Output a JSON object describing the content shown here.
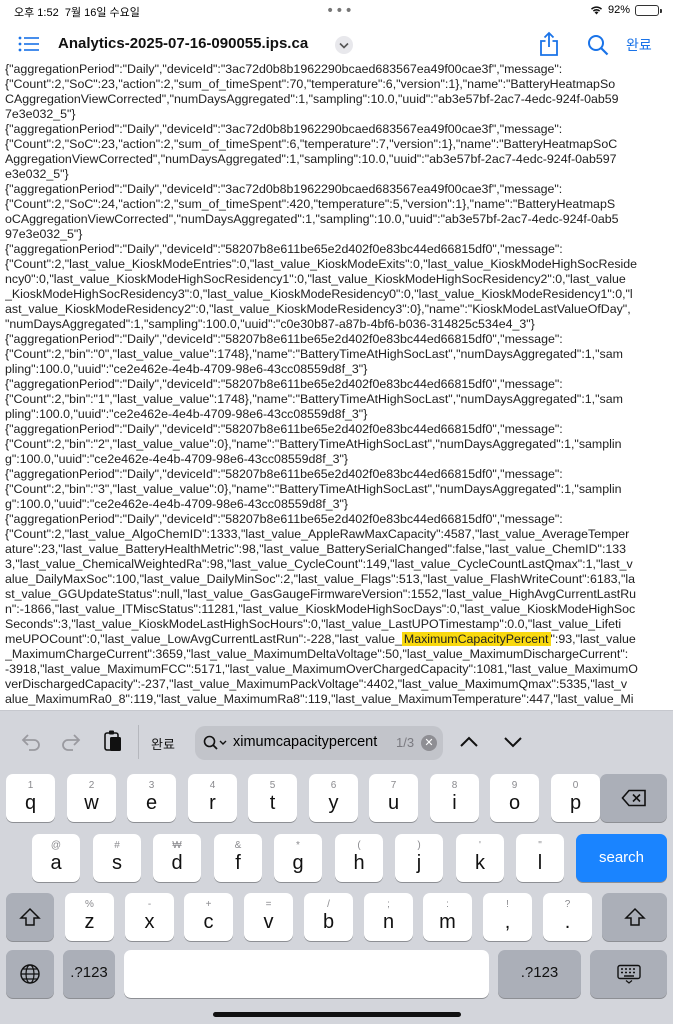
{
  "status": {
    "time": "오후 1:52",
    "date": "7월 16일 수요일",
    "battery": "92%",
    "battery_level": 0.92
  },
  "nav": {
    "title": "Analytics-2025-07-16-090055.ips.ca",
    "done": "완료"
  },
  "document": {
    "lines_before": [
      "{\"aggregationPeriod\":\"Daily\",\"deviceId\":\"3ac72d0b8b1962290bcaed683567ea49f00cae3f\",\"message\":",
      "{\"Count\":2,\"SoC\":23,\"action\":2,\"sum_of_timeSpent\":70,\"temperature\":6,\"version\":1},\"name\":\"BatteryHeatmapSo",
      "CAggregationViewCorrected\",\"numDaysAggregated\":1,\"sampling\":10.0,\"uuid\":\"ab3e57bf-2ac7-4edc-924f-0ab59",
      "7e3e032_5\"}",
      "{\"aggregationPeriod\":\"Daily\",\"deviceId\":\"3ac72d0b8b1962290bcaed683567ea49f00cae3f\",\"message\":",
      "{\"Count\":2,\"SoC\":23,\"action\":2,\"sum_of_timeSpent\":6,\"temperature\":7,\"version\":1},\"name\":\"BatteryHeatmapSoC",
      "AggregationViewCorrected\",\"numDaysAggregated\":1,\"sampling\":10.0,\"uuid\":\"ab3e57bf-2ac7-4edc-924f-0ab597",
      "e3e032_5\"}",
      "{\"aggregationPeriod\":\"Daily\",\"deviceId\":\"3ac72d0b8b1962290bcaed683567ea49f00cae3f\",\"message\":",
      "{\"Count\":2,\"SoC\":24,\"action\":2,\"sum_of_timeSpent\":420,\"temperature\":5,\"version\":1},\"name\":\"BatteryHeatmapS",
      "oCAggregationViewCorrected\",\"numDaysAggregated\":1,\"sampling\":10.0,\"uuid\":\"ab3e57bf-2ac7-4edc-924f-0ab5",
      "97e3e032_5\"}",
      "{\"aggregationPeriod\":\"Daily\",\"deviceId\":\"58207b8e611be65e2d402f0e83bc44ed66815df0\",\"message\":",
      "{\"Count\":2,\"last_value_KioskModeEntries\":0,\"last_value_KioskModeExits\":0,\"last_value_KioskModeHighSocReside",
      "ncy0\":0,\"last_value_KioskModeHighSocResidency1\":0,\"last_value_KioskModeHighSocResidency2\":0,\"last_value",
      "_KioskModeHighSocResidency3\":0,\"last_value_KioskModeResidency0\":0,\"last_value_KioskModeResidency1\":0,\"l",
      "ast_value_KioskModeResidency2\":0,\"last_value_KioskModeResidency3\":0},\"name\":\"KioskModeLastValueOfDay\",",
      "\"numDaysAggregated\":1,\"sampling\":100.0,\"uuid\":\"c0e30b87-a87b-4bf6-b036-314825c534e4_3\"}",
      "{\"aggregationPeriod\":\"Daily\",\"deviceId\":\"58207b8e611be65e2d402f0e83bc44ed66815df0\",\"message\":",
      "{\"Count\":2,\"bin\":\"0\",\"last_value_value\":1748},\"name\":\"BatteryTimeAtHighSocLast\",\"numDaysAggregated\":1,\"sam",
      "pling\":100.0,\"uuid\":\"ce2e462e-4e4b-4709-98e6-43cc08559d8f_3\"}",
      "{\"aggregationPeriod\":\"Daily\",\"deviceId\":\"58207b8e611be65e2d402f0e83bc44ed66815df0\",\"message\":",
      "{\"Count\":2,\"bin\":\"1\",\"last_value_value\":1748},\"name\":\"BatteryTimeAtHighSocLast\",\"numDaysAggregated\":1,\"sam",
      "pling\":100.0,\"uuid\":\"ce2e462e-4e4b-4709-98e6-43cc08559d8f_3\"}",
      "{\"aggregationPeriod\":\"Daily\",\"deviceId\":\"58207b8e611be65e2d402f0e83bc44ed66815df0\",\"message\":",
      "{\"Count\":2,\"bin\":\"2\",\"last_value_value\":0},\"name\":\"BatteryTimeAtHighSocLast\",\"numDaysAggregated\":1,\"samplin",
      "g\":100.0,\"uuid\":\"ce2e462e-4e4b-4709-98e6-43cc08559d8f_3\"}",
      "{\"aggregationPeriod\":\"Daily\",\"deviceId\":\"58207b8e611be65e2d402f0e83bc44ed66815df0\",\"message\":",
      "{\"Count\":2,\"bin\":\"3\",\"last_value_value\":0},\"name\":\"BatteryTimeAtHighSocLast\",\"numDaysAggregated\":1,\"samplin",
      "g\":100.0,\"uuid\":\"ce2e462e-4e4b-4709-98e6-43cc08559d8f_3\"}",
      "{\"aggregationPeriod\":\"Daily\",\"deviceId\":\"58207b8e611be65e2d402f0e83bc44ed66815df0\",\"message\":",
      "{\"Count\":2,\"last_value_AlgoChemID\":1333,\"last_value_AppleRawMaxCapacity\":4587,\"last_value_AverageTemper",
      "ature\":23,\"last_value_BatteryHealthMetric\":98,\"last_value_BatterySerialChanged\":false,\"last_value_ChemID\":133",
      "3,\"last_value_ChemicalWeightedRa\":98,\"last_value_CycleCount\":149,\"last_value_CycleCountLastQmax\":1,\"last_v",
      "alue_DailyMaxSoc\":100,\"last_value_DailyMinSoc\":2,\"last_value_Flags\":513,\"last_value_FlashWriteCount\":6183,\"la",
      "st_value_GGUpdateStatus\":null,\"last_value_GasGaugeFirmwareVersion\":1552,\"last_value_HighAvgCurrentLastRu",
      "n\":-1866,\"last_value_ITMiscStatus\":11281,\"last_value_KioskModeHighSocDays\":0,\"last_value_KioskModeHighSoc",
      "Seconds\":3,\"last_value_KioskModeLastHighSocHours\":0,\"last_value_LastUPOTimestamp\":0.0,\"last_value_Lifeti"
    ],
    "match_line_prefix": "meUPOCount\":0,\"last_value_LowAvgCurrentLastRun\":-228,\"last_value_",
    "match_text": "MaximumCapacityPercent",
    "match_line_suffix": "\":93,\"last_value",
    "lines_after": [
      "_MaximumChargeCurrent\":3659,\"last_value_MaximumDeltaVoltage\":50,\"last_value_MaximumDischargeCurrent\":",
      "-3918,\"last_value_MaximumFCC\":5171,\"last_value_MaximumOverChargedCapacity\":1081,\"last_value_MaximumO",
      "verDischargedCapacity\":-237,\"last_value_MaximumPackVoltage\":4402,\"last_value_MaximumQmax\":5335,\"last_v",
      "alue_MaximumRa0_8\":119,\"last_value_MaximumRa8\":119,\"last_value_MaximumTemperature\":447,\"last_value_Mi"
    ]
  },
  "find_bar": {
    "done": "완료",
    "query": "ximumcapacitypercent",
    "count": "1/3"
  },
  "keyboard": {
    "row1": [
      {
        "hint": "1",
        "key": "q"
      },
      {
        "hint": "2",
        "key": "w"
      },
      {
        "hint": "3",
        "key": "e"
      },
      {
        "hint": "4",
        "key": "r"
      },
      {
        "hint": "5",
        "key": "t"
      },
      {
        "hint": "6",
        "key": "y"
      },
      {
        "hint": "7",
        "key": "u"
      },
      {
        "hint": "8",
        "key": "i"
      },
      {
        "hint": "9",
        "key": "o"
      },
      {
        "hint": "0",
        "key": "p"
      }
    ],
    "row2": [
      {
        "hint": "@",
        "key": "a"
      },
      {
        "hint": "#",
        "key": "s"
      },
      {
        "hint": "₩",
        "key": "d"
      },
      {
        "hint": "&",
        "key": "f"
      },
      {
        "hint": "*",
        "key": "g"
      },
      {
        "hint": "(",
        "key": "h"
      },
      {
        "hint": ")",
        "key": "j"
      },
      {
        "hint": "'",
        "key": "k"
      },
      {
        "hint": "\"",
        "key": "l"
      }
    ],
    "search": "search",
    "row3": [
      {
        "hint": "%",
        "key": "z"
      },
      {
        "hint": "-",
        "key": "x"
      },
      {
        "hint": "+",
        "key": "c"
      },
      {
        "hint": "=",
        "key": "v"
      },
      {
        "hint": "/",
        "key": "b"
      },
      {
        "hint": ";",
        "key": "n"
      },
      {
        "hint": ":",
        "key": "m"
      },
      {
        "hint": "!",
        "key": ","
      },
      {
        "hint": "?",
        "key": "."
      }
    ],
    "numbers": ".?123"
  }
}
